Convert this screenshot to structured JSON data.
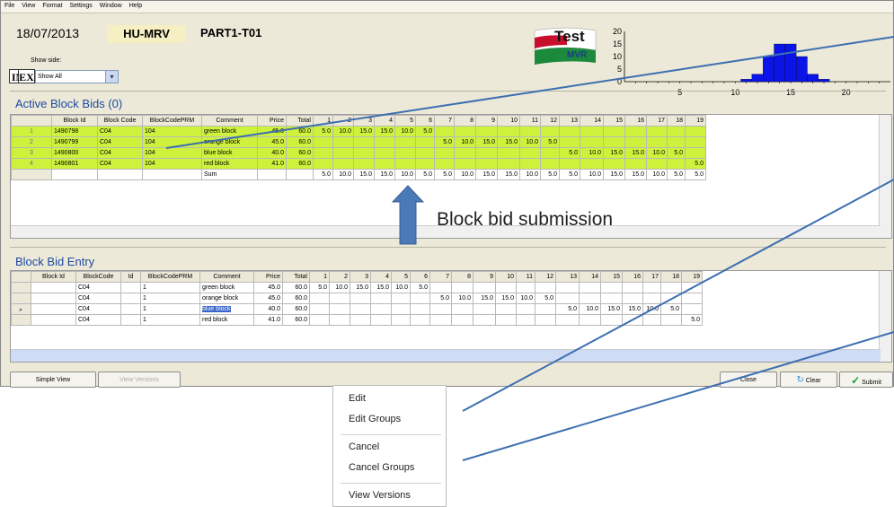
{
  "menu": [
    "File",
    "View",
    "Format",
    "Settings",
    "Window",
    "Help"
  ],
  "header": {
    "date": "18/07/2013",
    "area": "HU-MRV",
    "part": "PART1-T01"
  },
  "logo": {
    "line1": "Test",
    "line2": "MVR"
  },
  "histogram": {
    "type": "bar",
    "yticks": [
      "20",
      "15",
      "10",
      "5",
      "0"
    ],
    "xticks": [
      "5",
      "10",
      "15",
      "20"
    ],
    "x": [
      11,
      12,
      13,
      14,
      15,
      16,
      17,
      18
    ],
    "values": [
      1,
      3,
      10,
      15,
      15,
      10,
      3,
      1
    ],
    "xlim": [
      0,
      24
    ],
    "ylim": [
      0,
      20
    ]
  },
  "controls": {
    "show_side_label": "Show side:",
    "in_label": "IN",
    "ex_label": "EX",
    "show_side_value": "Show All"
  },
  "active": {
    "title": "Active Block Bids (0)",
    "columns": [
      "",
      "Block Id",
      "Block Code",
      "BlockCodePRM",
      "Comment",
      "Price",
      "Total",
      "1",
      "2",
      "3",
      "4",
      "5",
      "6",
      "7",
      "8",
      "9",
      "10",
      "11",
      "12",
      "13",
      "14",
      "15",
      "16",
      "17",
      "18",
      "19"
    ],
    "rows": [
      [
        "1",
        "1490798",
        "C04",
        "104",
        "green block",
        "45.0",
        "60.0",
        "5.0",
        "10.0",
        "15.0",
        "15.0",
        "10.0",
        "5.0",
        "",
        "",
        "",
        "",
        "",
        "",
        "",
        "",
        "",
        "",
        "",
        "",
        ""
      ],
      [
        "2",
        "1490799",
        "C04",
        "104",
        "orange block",
        "45.0",
        "60.0",
        "",
        "",
        "",
        "",
        "",
        "",
        "5.0",
        "10.0",
        "15.0",
        "15.0",
        "10.0",
        "5.0",
        "",
        "",
        "",
        "",
        "",
        "",
        ""
      ],
      [
        "3",
        "1490800",
        "C04",
        "104",
        "blue block",
        "40.0",
        "60.0",
        "",
        "",
        "",
        "",
        "",
        "",
        "",
        "",
        "",
        "",
        "",
        "",
        "5.0",
        "10.0",
        "15.0",
        "15.0",
        "10.0",
        "5.0",
        ""
      ],
      [
        "4",
        "1490801",
        "C04",
        "104",
        "red block",
        "41.0",
        "60.0",
        "",
        "",
        "",
        "",
        "",
        "",
        "",
        "",
        "",
        "",
        "",
        "",
        "",
        "",
        "",
        "",
        "",
        "",
        "5.0"
      ]
    ],
    "sum": [
      "",
      "",
      "",
      "",
      "Sum",
      "",
      "",
      "5.0",
      "10.0",
      "15.0",
      "15.0",
      "10.0",
      "5.0",
      "5.0",
      "10.0",
      "15.0",
      "15.0",
      "10.0",
      "5.0",
      "5.0",
      "10.0",
      "15.0",
      "15.0",
      "10.0",
      "5.0",
      "5.0"
    ]
  },
  "annotation": {
    "text": "Block bid submission"
  },
  "entry": {
    "title": "Block Bid Entry",
    "columns": [
      "",
      "Block Id",
      "BlockCode",
      "Id",
      "BlockCodePRM",
      "Comment",
      "Price",
      "Total",
      "1",
      "2",
      "3",
      "4",
      "5",
      "6",
      "7",
      "8",
      "9",
      "10",
      "11",
      "12",
      "13",
      "14",
      "15",
      "16",
      "17",
      "18",
      "19"
    ],
    "rows": [
      [
        "",
        "",
        "C04",
        "",
        "1",
        "green block",
        "45.0",
        "60.0",
        "5.0",
        "10.0",
        "15.0",
        "15.0",
        "10.0",
        "5.0",
        "",
        "",
        "",
        "",
        "",
        "",
        "",
        "",
        "",
        "",
        "",
        "",
        ""
      ],
      [
        "",
        "",
        "C04",
        "",
        "1",
        "orange block",
        "45.0",
        "60.0",
        "",
        "",
        "",
        "",
        "",
        "",
        "5.0",
        "10.0",
        "15.0",
        "15.0",
        "10.0",
        "5.0",
        "",
        "",
        "",
        "",
        "",
        "",
        ""
      ],
      [
        "▸",
        "",
        "C04",
        "",
        "1",
        "blue block",
        "40.0",
        "60.0",
        "",
        "",
        "",
        "",
        "",
        "",
        "",
        "",
        "",
        "",
        "",
        "",
        "5.0",
        "10.0",
        "15.0",
        "15.0",
        "10.0",
        "5.0",
        ""
      ],
      [
        "",
        "",
        "C04",
        "",
        "1",
        "red block",
        "41.0",
        "60.0",
        "",
        "",
        "",
        "",
        "",
        "",
        "",
        "",
        "",
        "",
        "",
        "",
        "",
        "",
        "",
        "",
        "",
        "",
        "5.0"
      ]
    ]
  },
  "buttons": {
    "simple_view": "Simple View",
    "view_versions": "View Versions",
    "close": "Close",
    "clear": "Clear",
    "submit": "Submit"
  },
  "context_menu": [
    "Edit",
    "Edit Groups",
    "Cancel",
    "Cancel Groups",
    "View Versions"
  ],
  "colors": {
    "active_row": "#cef23b",
    "title_blue": "#1c4aa3",
    "arrow_blue": "#4a79b8"
  }
}
